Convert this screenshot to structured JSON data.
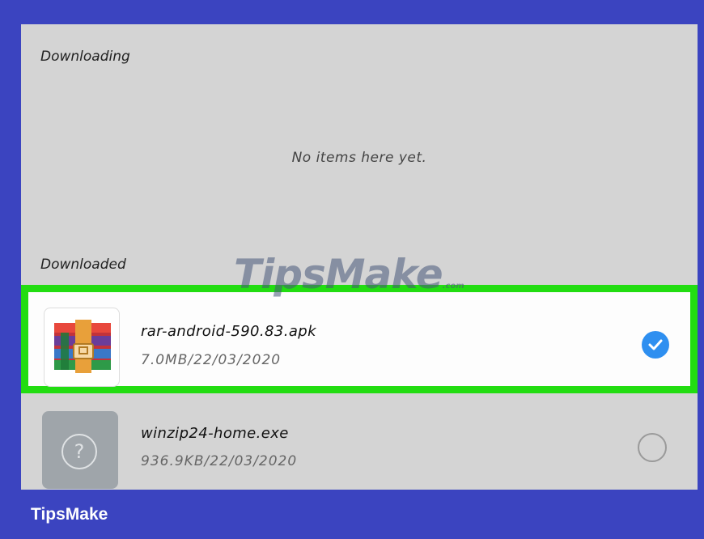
{
  "downloading": {
    "label": "Downloading",
    "empty_text": "No items here yet."
  },
  "downloaded": {
    "label": "Downloaded",
    "items": [
      {
        "name": "rar-android-590.83.apk",
        "meta": "7.0MB/22/03/2020",
        "selected": true,
        "icon": "winrar-icon"
      },
      {
        "name": "winzip24-home.exe",
        "meta": "936.9KB/22/03/2020",
        "selected": false,
        "icon": "unknown-file-icon"
      }
    ]
  },
  "watermark": {
    "text": "TipsMake",
    "suffix": ".com"
  },
  "brand": {
    "text": "TipsMake"
  },
  "colors": {
    "frame": "#3b44c0",
    "highlight": "#22dd11",
    "check": "#2e8ff0",
    "screen_bg": "#d4d4d4"
  }
}
